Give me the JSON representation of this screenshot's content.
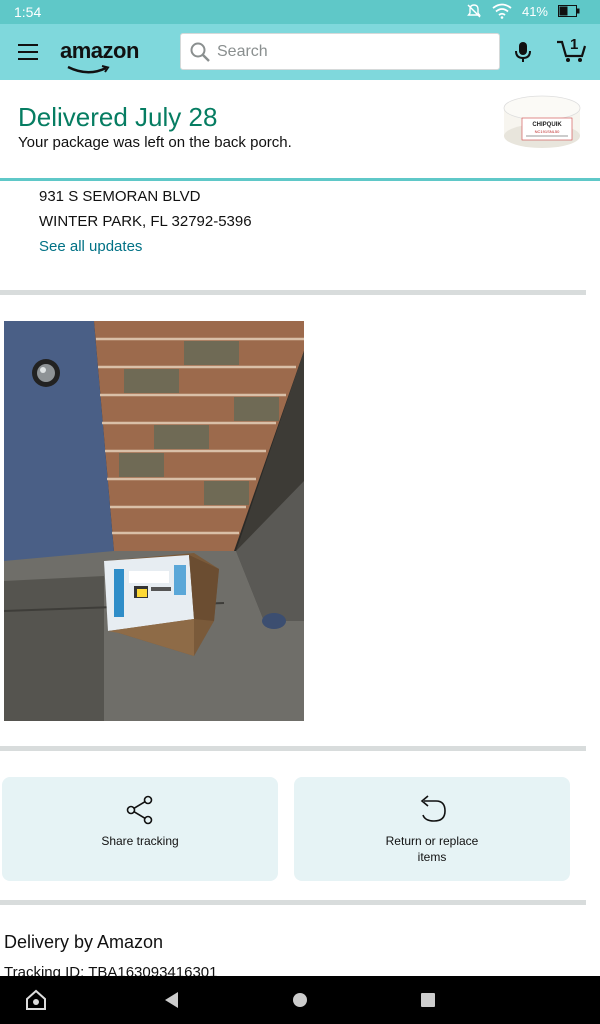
{
  "status_bar": {
    "time": "1:54",
    "battery": "41%"
  },
  "header": {
    "logo": "amazon",
    "search": {
      "placeholder": "Search",
      "value": ""
    },
    "cart_count": "1"
  },
  "delivery": {
    "title": "Delivered July 28",
    "subtitle": "Your package was left on the back porch.",
    "product_label": "CHIPQUIK",
    "product_code": "NC191SNL50",
    "address_line1": "931 S SEMORAN BLVD",
    "address_line2": "WINTER PARK, FL 32792-5396",
    "see_all_label": "See all updates"
  },
  "actions": {
    "share_label": "Share tracking",
    "return_label": "Return or replace items"
  },
  "shipment": {
    "heading": "Delivery by Amazon",
    "tracking": "Tracking ID: TBA163093416301"
  },
  "colors": {
    "teal_header": "#7fd8dc",
    "status_bar": "#5fc8c8",
    "delivered_green": "#067d62",
    "link": "#007185"
  }
}
